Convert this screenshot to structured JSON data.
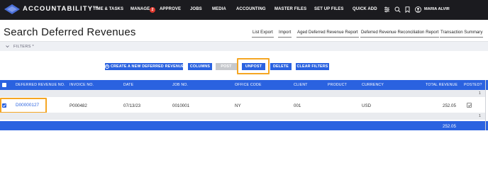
{
  "app": {
    "logo_text": "ACCOUNTABILITY",
    "logo_tm": "TM",
    "nav": [
      "TIME & TASKS",
      "MANAGE",
      "APPROVE",
      "JOBS",
      "MEDIA",
      "ACCOUNTING",
      "MASTER FILES",
      "SET UP FILES",
      "QUICK ADD"
    ],
    "manage_badge": "2",
    "user_name": "MARIA ALVIR",
    "icons": [
      "sliders-icon",
      "search-icon",
      "bookmark-icon",
      "user-icon"
    ]
  },
  "page": {
    "title": "Search Deferred Revenues",
    "toolbar": [
      "List Export",
      "Import",
      "Aged Deferred Revenue Report",
      "Deferred Revenue Reconciliation Report",
      "Transaction Summary"
    ],
    "filters_label": "FILTERS *"
  },
  "actions": {
    "create": "CREATE A NEW DEFERRED REVENUE",
    "columns": "COLUMNS",
    "post": "POST",
    "unpost": "UNPOST",
    "delete": "DELETE",
    "clear": "CLEAR FILTERS"
  },
  "table": {
    "headers": [
      "DEFERRED REVENUE NO.",
      "INVOICE NO.",
      "DATE",
      "JOB NO.",
      "OFFICE CODE",
      "CLIENT",
      "PRODUCT",
      "CURRENCY",
      "TOTAL REVENUE",
      "POSTED?"
    ],
    "group_count_top": "1",
    "group_count_bottom": "1",
    "rows": [
      {
        "deferred_revenue_no": "D00000127",
        "invoice_no": "P000482",
        "date": "07/13/23",
        "job_no": "0010001",
        "office_code": "NY",
        "client": "001",
        "product": "",
        "currency": "USD",
        "total_revenue": "252.05",
        "selected": true,
        "posted": true
      }
    ],
    "grand_total": "252.05"
  },
  "colors": {
    "nav_bg": "#1b1b1f",
    "accent": "#2a62e0",
    "highlight": "#f5a623",
    "badge": "#e03a2f",
    "disabled": "#c7c9cd"
  }
}
